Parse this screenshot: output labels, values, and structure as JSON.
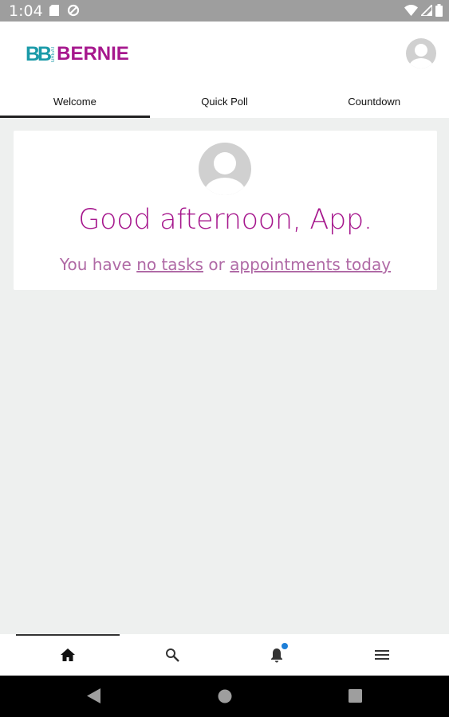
{
  "status_bar": {
    "time": "1:04",
    "icons": [
      "sd-card-icon",
      "data-saver-icon",
      "wifi-icon",
      "signal-icon",
      "battery-icon"
    ]
  },
  "header": {
    "logo_initials": "BB",
    "logo_small": "GREAT",
    "logo_name": "BERNIE",
    "avatar_icon": "user-avatar-icon"
  },
  "tabs": [
    {
      "label": "Welcome",
      "active": true
    },
    {
      "label": "Quick Poll",
      "active": false
    },
    {
      "label": "Countdown",
      "active": false
    }
  ],
  "welcome_card": {
    "greeting": "Good afternoon, App.",
    "sub_prefix": "You have ",
    "tasks_link": "no tasks",
    "sub_middle": " or ",
    "appointments_link": "appointments today"
  },
  "bottom_nav": [
    {
      "icon": "home-icon",
      "active": true
    },
    {
      "icon": "search-icon",
      "active": false
    },
    {
      "icon": "bell-icon",
      "active": false,
      "badge": true
    },
    {
      "icon": "menu-icon",
      "active": false
    }
  ],
  "system_nav": [
    "back-icon",
    "home-circle-icon",
    "recents-icon"
  ],
  "colors": {
    "brand_magenta": "#a6178d",
    "brand_teal": "#1a9aa8",
    "background": "#eef0ef",
    "badge_blue": "#1e7fd8"
  }
}
